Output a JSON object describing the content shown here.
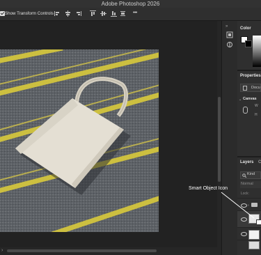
{
  "window": {
    "title": "Adobe Photoshop 2026"
  },
  "options_bar": {
    "show_transform_controls": {
      "label": "Show Transform Controls",
      "checked": true
    },
    "icons": [
      "align-left-icon",
      "align-center-icon",
      "align-right-icon",
      "align-top-icon",
      "align-middle-icon",
      "align-bottom-icon",
      "distribute-vertical-icon",
      "distribute-horizontal-icon",
      "more-icon",
      "gear-icon"
    ],
    "more_label": "•••"
  },
  "panels": {
    "color": {
      "tab_label": "Color",
      "foreground": "#ffffff",
      "background": "#000000"
    },
    "properties": {
      "tab_label": "Properties",
      "document_label": "Docu",
      "canvas_heading": "Canvas",
      "w_label": "W",
      "h_label": "H"
    },
    "layers": {
      "tab_label": "Layers",
      "tab_partial": "C",
      "kind_label": "Kind",
      "blend_mode": "Normal",
      "lock_label": "Lock:"
    }
  },
  "canvas": {
    "image": "tote-bag-on-road-photo",
    "accent_line_color": "#d8c93b"
  },
  "annotation": {
    "text": "Smart Object Icon"
  },
  "hscroll": {
    "arrow": "›"
  }
}
